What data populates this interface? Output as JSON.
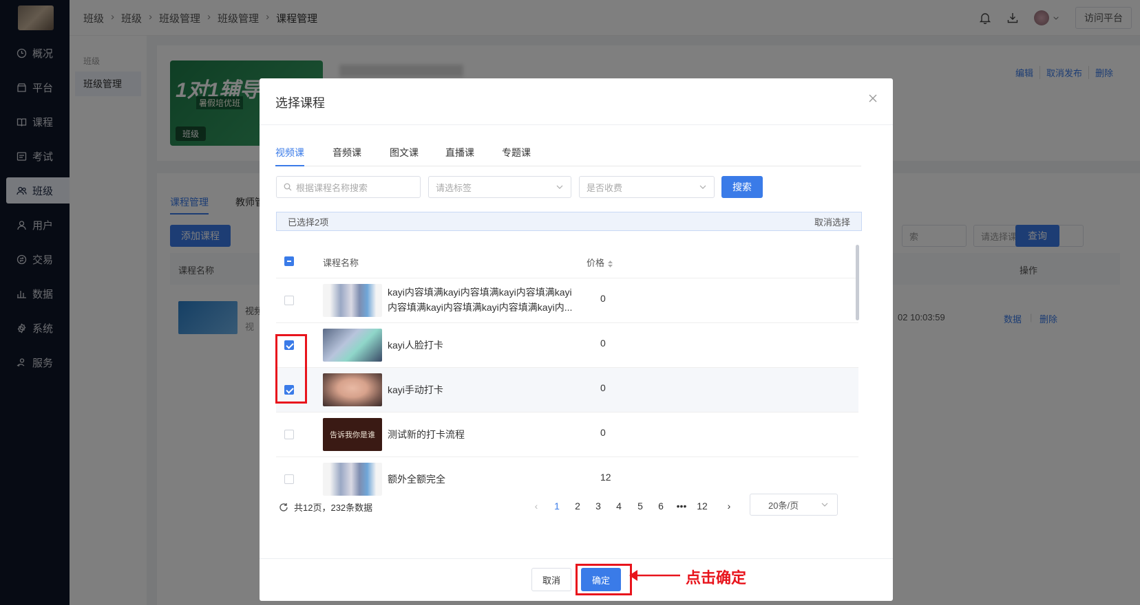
{
  "sidebar": {
    "items": [
      {
        "label": "概况",
        "icon": "clock-icon"
      },
      {
        "label": "平台",
        "icon": "store-icon"
      },
      {
        "label": "课程",
        "icon": "book-icon"
      },
      {
        "label": "考试",
        "icon": "exam-icon"
      },
      {
        "label": "班级",
        "icon": "users-icon",
        "active": true
      },
      {
        "label": "用户",
        "icon": "user-icon"
      },
      {
        "label": "交易",
        "icon": "exchange-icon"
      },
      {
        "label": "数据",
        "icon": "bar-chart-icon"
      },
      {
        "label": "系统",
        "icon": "settings-icon"
      },
      {
        "label": "服务",
        "icon": "service-icon"
      }
    ]
  },
  "topbar": {
    "breadcrumb": [
      "班级",
      "班级",
      "班级管理",
      "班级管理",
      "课程管理"
    ],
    "visit_label": "访问平台"
  },
  "subnav": {
    "title": "班级",
    "item": "班级管理"
  },
  "class_card": {
    "cover_text": "1对1辅导",
    "cover_sub": "暑假培优班",
    "badge": "班级",
    "actions": [
      "编辑",
      "取消发布",
      "删除"
    ]
  },
  "course_panel": {
    "tabs": [
      "课程管理",
      "教师管"
    ],
    "add_label": "添加课程",
    "search_placeholder_tail": "索",
    "type_placeholder": "请选择课程类型",
    "query_label": "查询",
    "col_name": "课程名称",
    "col_action": "操作",
    "row": {
      "title": "视频",
      "sub": "视",
      "time": "02 10:03:59",
      "data_link": "数据",
      "delete_link": "删除"
    }
  },
  "dialog": {
    "title": "选择课程",
    "tabs": [
      "视频课",
      "音频课",
      "图文课",
      "直播课",
      "专题课"
    ],
    "active_tab": 0,
    "search_placeholder": "根据课程名称搜索",
    "tag_placeholder": "请选标签",
    "fee_placeholder": "是否收费",
    "search_label": "搜索",
    "selected_text": "已选择2项",
    "clear_label": "取消选择",
    "columns": {
      "name": "课程名称",
      "price": "价格"
    },
    "rows": [
      {
        "name": "kayi内容填满kayi内容填满kayi内容填满kayi内容填满kayi内容填满kayi内容填满kayi内...",
        "price": "0",
        "thumb": "dress",
        "checked": false
      },
      {
        "name": "kayi人脸打卡",
        "price": "0",
        "thumb": "people",
        "checked": true
      },
      {
        "name": "kayi手动打卡",
        "price": "0",
        "thumb": "face",
        "checked": true
      },
      {
        "name": "测试新的打卡流程",
        "price": "0",
        "thumb": "dark",
        "thumb_text": "告诉我你是谁",
        "checked": false
      },
      {
        "name": "额外全额完全",
        "price": "12",
        "thumb": "dress",
        "checked": false
      }
    ],
    "pager": {
      "summary": "共12页，232条数据",
      "pages": [
        "1",
        "2",
        "3",
        "4",
        "5",
        "6",
        "•••",
        "12"
      ],
      "current": "1",
      "page_size": "20条/页"
    },
    "cancel_label": "取消",
    "ok_label": "确定"
  },
  "annotation": {
    "text": "点击确定",
    "color": "#e8141c"
  },
  "colors": {
    "primary": "#3a7be8",
    "sidebar": "#0f1729"
  }
}
